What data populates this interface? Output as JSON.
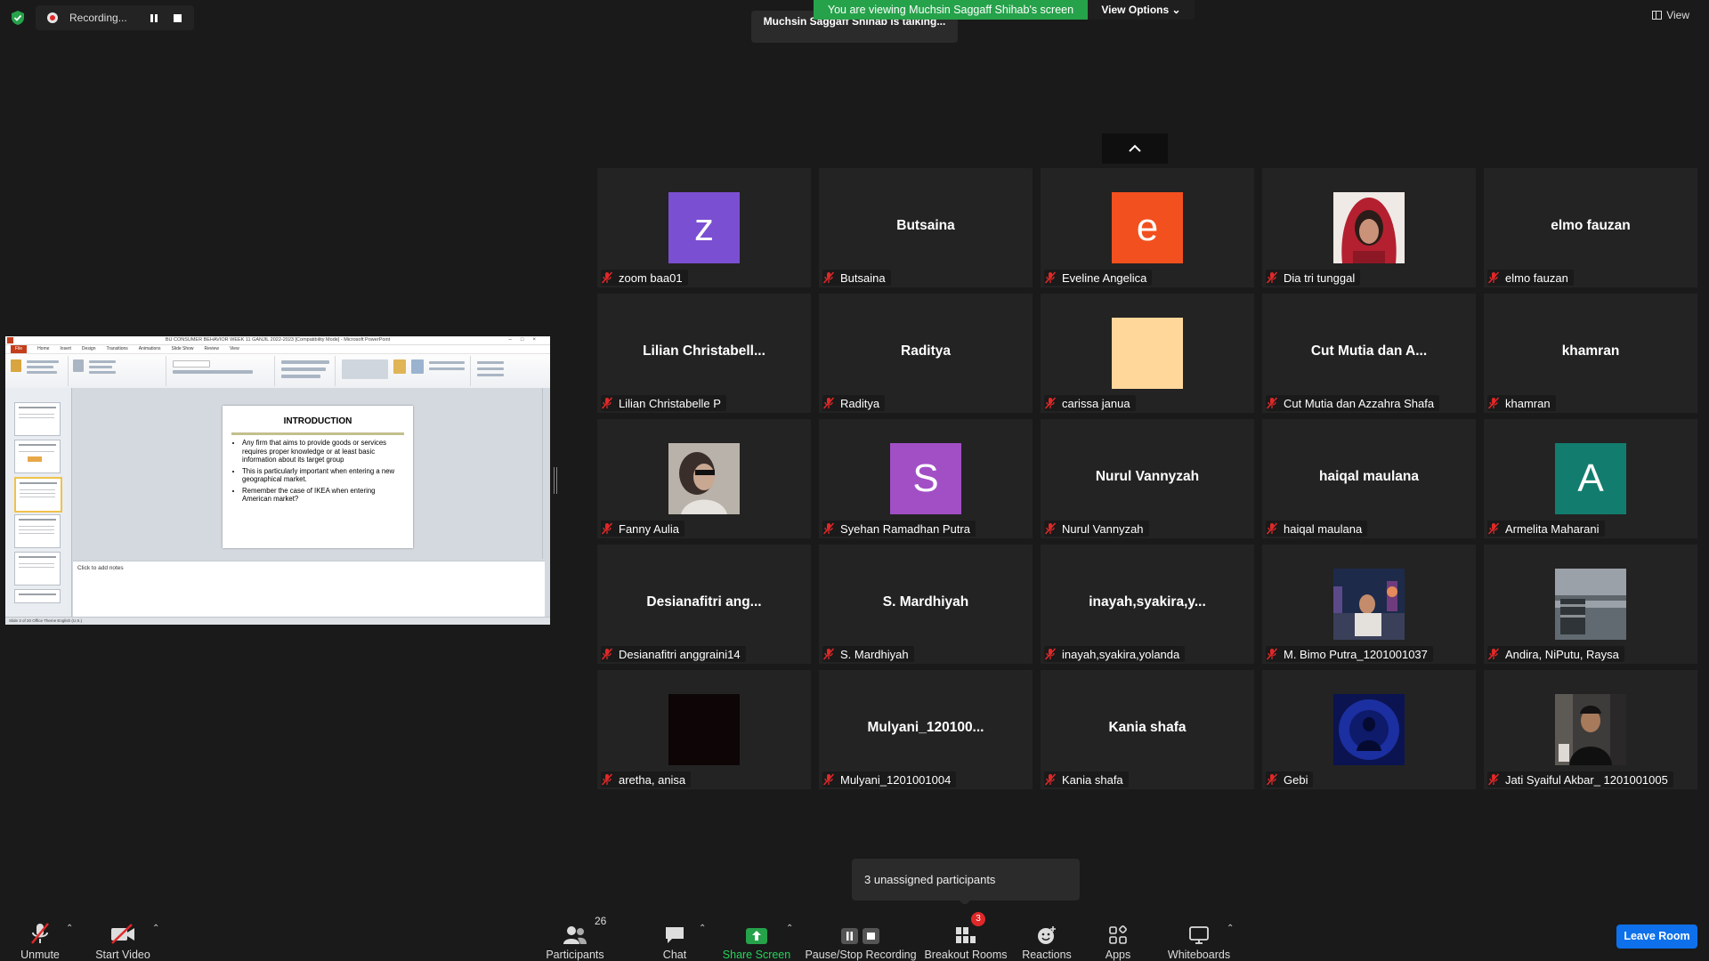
{
  "top": {
    "recording_label": "Recording...",
    "talking_text": "Muchsin Saggaff Shihab is talking...",
    "viewing_banner": "You are viewing Muchsin Saggaff Shihab's screen",
    "view_options_label": "View Options",
    "view_label": "View"
  },
  "share": {
    "window_title": "BU CONSUMER BEHAVIOR WEEK 11 GANJIL 2022-2023 [Compatibility Mode] - Microsoft PowerPoint",
    "ribbon_tabs": [
      "File",
      "Home",
      "Insert",
      "Design",
      "Transitions",
      "Animations",
      "Slide Show",
      "Review",
      "View"
    ],
    "slide_title": "INTRODUCTION",
    "bullets": [
      "Any firm that aims to provide goods or services requires proper knowledge or at least basic information about its target group",
      "This is particularly important when entering a new geographical market.",
      "Remember the case of IKEA when entering American market?"
    ],
    "notes_placeholder": "Click to add notes",
    "status_text": "Slide 3 of 20    Office Theme    English (U.S.)"
  },
  "participants": [
    {
      "name": "zoom baa01",
      "avatar_type": "letter",
      "letter": "z",
      "color": "#7b4fd1"
    },
    {
      "name": "Butsaina",
      "avatar_type": "text",
      "big": "Butsaina"
    },
    {
      "name": "Eveline Angelica",
      "avatar_type": "letter",
      "letter": "e",
      "color": "#f2501e"
    },
    {
      "name": "Dia tri tunggal",
      "avatar_type": "photo",
      "photo": "red-hood"
    },
    {
      "name": "elmo fauzan",
      "avatar_type": "text",
      "big": "elmo fauzan"
    },
    {
      "name": "Lilian Christabelle P",
      "avatar_type": "text",
      "big": "Lilian  Christabell..."
    },
    {
      "name": "Raditya",
      "avatar_type": "text",
      "big": "Raditya"
    },
    {
      "name": "carissa janua",
      "avatar_type": "solid",
      "color": "#ffd79b"
    },
    {
      "name": "Cut Mutia dan Azzahra Shafa",
      "avatar_type": "text",
      "big": "Cut Mutia dan A..."
    },
    {
      "name": "khamran",
      "avatar_type": "text",
      "big": "khamran"
    },
    {
      "name": "Fanny Aulia",
      "avatar_type": "photo",
      "photo": "blurry-portrait"
    },
    {
      "name": "Syehan Ramadhan Putra",
      "avatar_type": "letter",
      "letter": "S",
      "color": "#a24fc6"
    },
    {
      "name": "Nurul Vannyzah",
      "avatar_type": "text",
      "big": "Nurul Vannyzah"
    },
    {
      "name": "haiqal maulana",
      "avatar_type": "text",
      "big": "haiqal maulana"
    },
    {
      "name": "Armelita Maharani",
      "avatar_type": "letter",
      "letter": "A",
      "color": "#127d6e"
    },
    {
      "name": "Desianafitri anggraini14",
      "avatar_type": "text",
      "big": "Desianafitri  ang..."
    },
    {
      "name": "S. Mardhiyah",
      "avatar_type": "text",
      "big": "S. Mardhiyah"
    },
    {
      "name": "inayah,syakira,yolanda",
      "avatar_type": "text",
      "big": "inayah,syakira,y..."
    },
    {
      "name": "M. Bimo Putra_1201001037",
      "avatar_type": "photo",
      "photo": "night-city"
    },
    {
      "name": "Andira, NiPutu, Raysa",
      "avatar_type": "photo",
      "photo": "waterfront"
    },
    {
      "name": "aretha, anisa",
      "avatar_type": "solid",
      "color": "#0e0606"
    },
    {
      "name": "Mulyani_1201001004",
      "avatar_type": "text",
      "big": "Mulyani_120100..."
    },
    {
      "name": "Kania shafa",
      "avatar_type": "text",
      "big": "Kania shafa"
    },
    {
      "name": "Gebi",
      "avatar_type": "photo",
      "photo": "blue-silhouette"
    },
    {
      "name": "Jati Syaiful Akbar_ 1201001005",
      "avatar_type": "photo",
      "photo": "selfie"
    }
  ],
  "toast": "3 unassigned participants",
  "toolbar": {
    "unmute": "Unmute",
    "start_video": "Start Video",
    "participants": "Participants",
    "participants_count": "26",
    "chat": "Chat",
    "share_screen": "Share Screen",
    "pause_stop": "Pause/Stop Recording",
    "breakout": "Breakout Rooms",
    "breakout_count": "3",
    "reactions": "Reactions",
    "apps": "Apps",
    "whiteboards": "Whiteboards",
    "leave": "Leave Room"
  },
  "colors": {
    "background": "#1a1a1a",
    "tile": "#232323",
    "green": "#25a24a",
    "leave_blue": "#0e71eb",
    "muted_red": "#e02828"
  }
}
